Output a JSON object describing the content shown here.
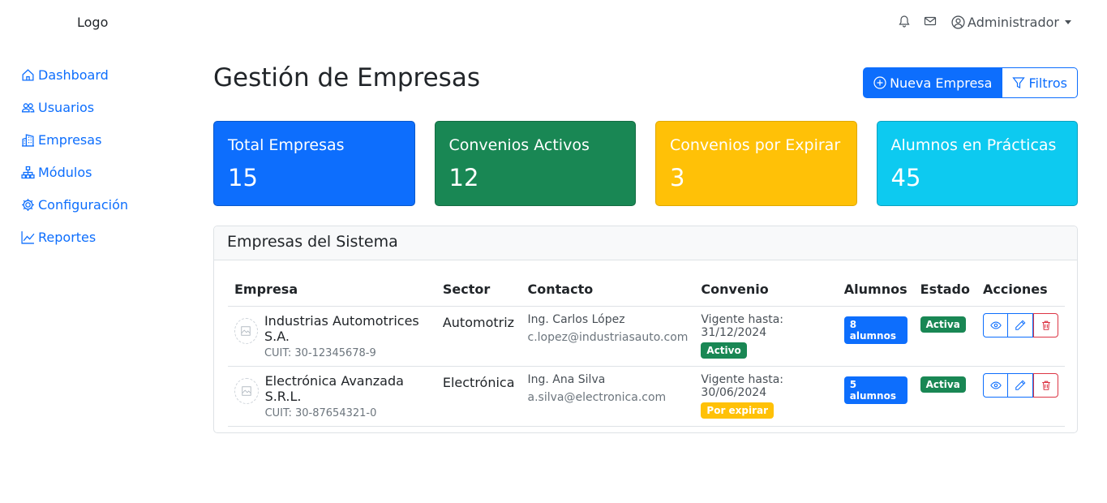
{
  "logo": "Logo",
  "topbar": {
    "notifications_icon": "bell-icon",
    "messages_icon": "envelope-icon",
    "user_name": "Administrador"
  },
  "sidebar": {
    "items": [
      {
        "label": "Dashboard",
        "icon": "house-icon"
      },
      {
        "label": "Usuarios",
        "icon": "people-icon"
      },
      {
        "label": "Empresas",
        "icon": "building-icon"
      },
      {
        "label": "Módulos",
        "icon": "diagram-icon"
      },
      {
        "label": "Configuración",
        "icon": "gear-icon"
      },
      {
        "label": "Reportes",
        "icon": "graph-icon"
      }
    ]
  },
  "header": {
    "title": "Gestión de Empresas",
    "new_button": "Nueva Empresa",
    "filters_button": "Filtros"
  },
  "stats": [
    {
      "title": "Total Empresas",
      "value": "15",
      "color": "#0d6efd"
    },
    {
      "title": "Convenios Activos",
      "value": "12",
      "color": "#198754"
    },
    {
      "title": "Convenios por Expirar",
      "value": "3",
      "color": "#ffc107"
    },
    {
      "title": "Alumnos en Prácticas",
      "value": "45",
      "color": "#0dcaf0"
    }
  ],
  "table": {
    "title": "Empresas del Sistema",
    "columns": [
      "Empresa",
      "Sector",
      "Contacto",
      "Convenio",
      "Alumnos",
      "Estado",
      "Acciones"
    ],
    "rows": [
      {
        "name": "Industrias Automotrices S.A.",
        "cuit": "CUIT: 30-12345678-9",
        "sector": "Automotriz",
        "contact_name": "Ing. Carlos López",
        "contact_email": "c.lopez@industriasauto.com",
        "convenio": "Vigente hasta: 31/12/2024",
        "convenio_badge": "Activo",
        "alumnos": "8 alumnos",
        "estado": "Activa"
      },
      {
        "name": "Electrónica Avanzada S.R.L.",
        "cuit": "CUIT: 30-87654321-0",
        "sector": "Electrónica",
        "contact_name": "Ing. Ana Silva",
        "contact_email": "a.silva@electronica.com",
        "convenio": "Vigente hasta: 30/06/2024",
        "convenio_badge": "Por expirar",
        "alumnos": "5 alumnos",
        "estado": "Activa"
      }
    ]
  }
}
